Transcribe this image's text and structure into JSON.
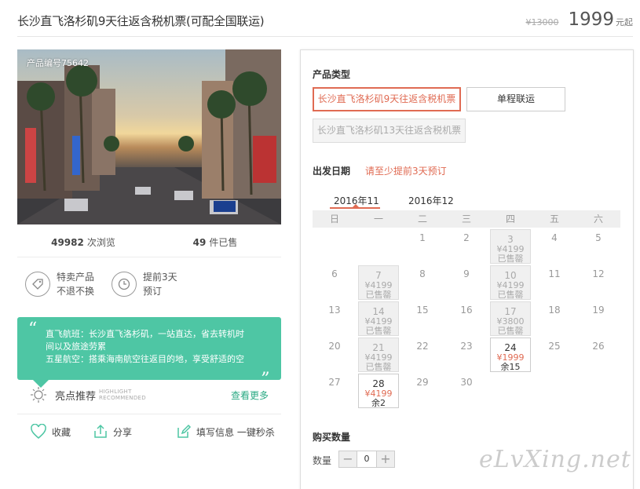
{
  "header": {
    "title": "长沙直飞洛杉矶9天往返含税机票(可配全国联运)",
    "old_price": "¥13000",
    "price": "1999",
    "price_suffix": "元起"
  },
  "photo": {
    "product_no": "产品编号75642"
  },
  "stats": {
    "views_num": "49982",
    "views_label": "次浏览",
    "sold_num": "49",
    "sold_label": "件已售"
  },
  "features": [
    {
      "icon": "tag-icon",
      "line1": "特卖产品",
      "line2": "不退不换"
    },
    {
      "icon": "clock-icon",
      "line1": "提前3天",
      "line2": "预订"
    }
  ],
  "highlight": {
    "line1": "直飞航班：长沙直飞洛杉矶，一站直达，省去转机时",
    "line2": "间以及旅途劳累",
    "line3": "五星航空：搭乘海南航空往返目的地，享受舒适的空",
    "title": "亮点推荐",
    "sub1": "HIGHLIGHT",
    "sub2": "RECOMMENDED",
    "more": "查看更多"
  },
  "actions": {
    "fav": "收藏",
    "share": "分享",
    "fill": "填写信息 一键秒杀"
  },
  "product_type": {
    "label": "产品类型",
    "options": [
      {
        "label": "长沙直飞洛杉矶9天往返含税机票",
        "state": "selected"
      },
      {
        "label": "单程联运",
        "state": "normal"
      },
      {
        "label": "长沙直飞洛杉矶13天往返含税机票",
        "state": "disabled"
      }
    ]
  },
  "departure": {
    "label": "出发日期",
    "hint": "请至少提前3天预订",
    "months": [
      "2016年11",
      "2016年12"
    ],
    "weekdays": [
      "日",
      "一",
      "二",
      "三",
      "四",
      "五",
      "六"
    ],
    "weeks": [
      [
        {},
        {},
        {
          "d": "1"
        },
        {
          "d": "2"
        },
        {
          "d": "3",
          "p": "¥4199",
          "s": "已售罄",
          "state": "soldout"
        },
        {
          "d": "4"
        },
        {
          "d": "5"
        }
      ],
      [
        {
          "d": "6"
        },
        {
          "d": "7",
          "p": "¥4199",
          "s": "已售罄",
          "state": "soldout"
        },
        {
          "d": "8"
        },
        {
          "d": "9"
        },
        {
          "d": "10",
          "p": "¥4199",
          "s": "已售罄",
          "state": "soldout"
        },
        {
          "d": "11"
        },
        {
          "d": "12"
        }
      ],
      [
        {
          "d": "13"
        },
        {
          "d": "14",
          "p": "¥4199",
          "s": "已售罄",
          "state": "soldout"
        },
        {
          "d": "15"
        },
        {
          "d": "16"
        },
        {
          "d": "17",
          "p": "¥3800",
          "s": "已售罄",
          "state": "soldout"
        },
        {
          "d": "18"
        },
        {
          "d": "19"
        }
      ],
      [
        {
          "d": "20"
        },
        {
          "d": "21",
          "p": "¥4199",
          "s": "已售罄",
          "state": "soldout"
        },
        {
          "d": "22"
        },
        {
          "d": "23"
        },
        {
          "d": "24",
          "p": "¥1999",
          "s": "余15",
          "state": "avail"
        },
        {
          "d": "25"
        },
        {
          "d": "26"
        }
      ],
      [
        {
          "d": "27"
        },
        {
          "d": "28",
          "p": "¥4199",
          "s": "余2",
          "state": "avail"
        },
        {
          "d": "29"
        },
        {
          "d": "30"
        },
        {},
        {},
        {}
      ]
    ]
  },
  "quantity": {
    "label": "购买数量",
    "field_label": "数量",
    "value": "0",
    "minus": "−",
    "plus": "+"
  },
  "watermark": "eLvXing.net"
}
